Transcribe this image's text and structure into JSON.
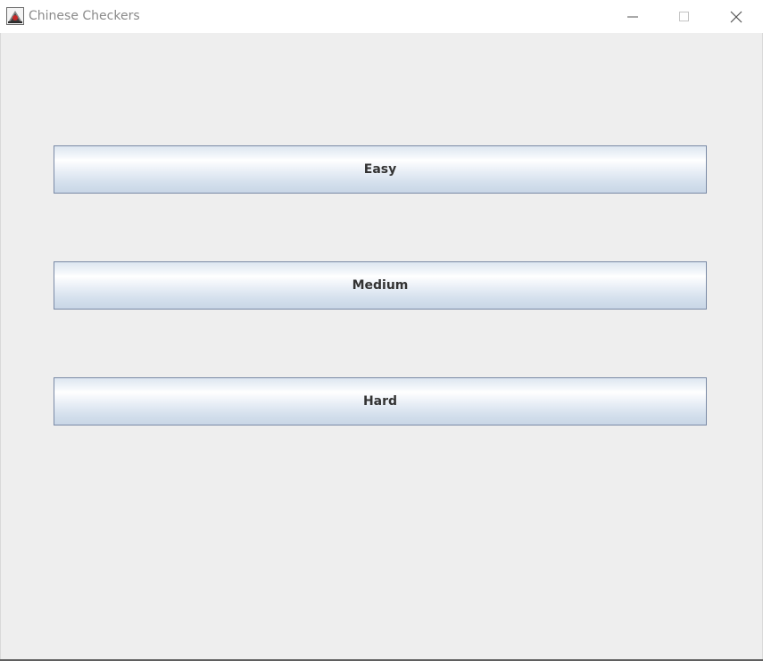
{
  "window": {
    "title": "Chinese Checkers",
    "controls": {
      "minimize_icon": "minimize-icon",
      "maximize_icon": "maximize-icon",
      "close_icon": "close-icon"
    }
  },
  "difficulty": {
    "buttons": [
      {
        "label": "Easy"
      },
      {
        "label": "Medium"
      },
      {
        "label": "Hard"
      }
    ]
  },
  "colors": {
    "background": "#eeeeee",
    "button_border": "#7a8aa6",
    "button_text": "#333333"
  }
}
